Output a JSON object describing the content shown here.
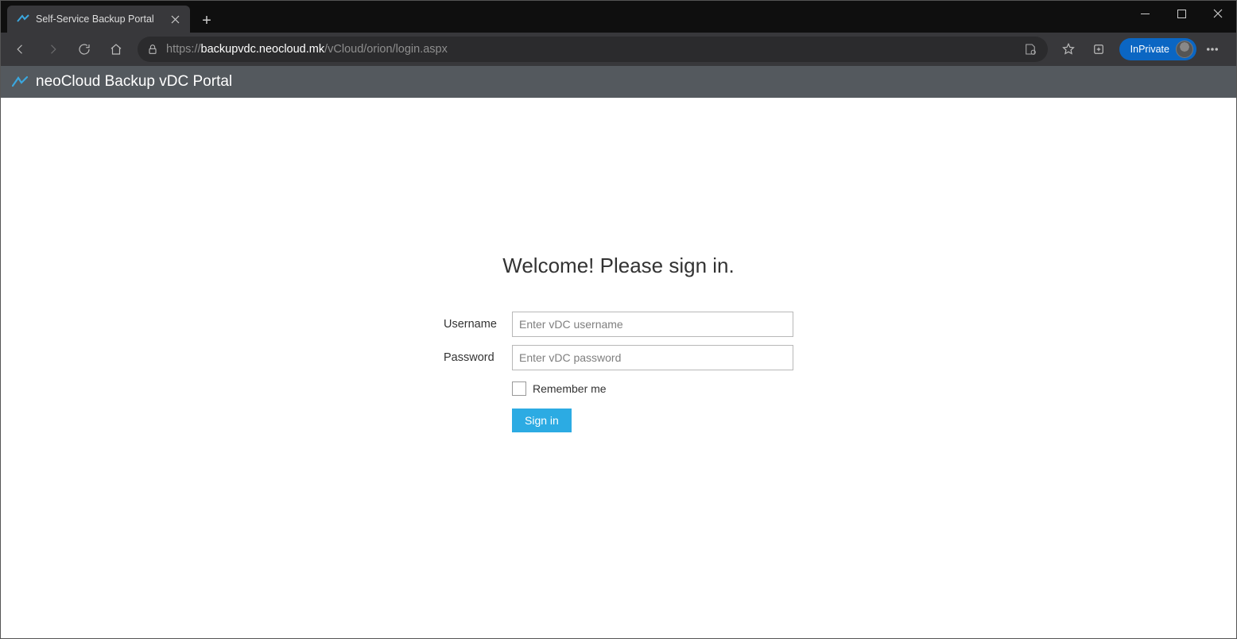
{
  "browser": {
    "tab_title": "Self-Service Backup Portal",
    "url_scheme": "https://",
    "url_host": "backupvdc.neocloud.mk",
    "url_path": "/vCloud/orion/login.aspx",
    "inprivate_label": "InPrivate"
  },
  "app_header": {
    "title": "neoCloud Backup vDC Portal"
  },
  "login": {
    "heading": "Welcome! Please sign in.",
    "username_label": "Username",
    "username_placeholder": "Enter vDC username",
    "username_value": "",
    "password_label": "Password",
    "password_placeholder": "Enter vDC password",
    "password_value": "",
    "remember_label": "Remember me",
    "signin_label": "Sign in"
  }
}
